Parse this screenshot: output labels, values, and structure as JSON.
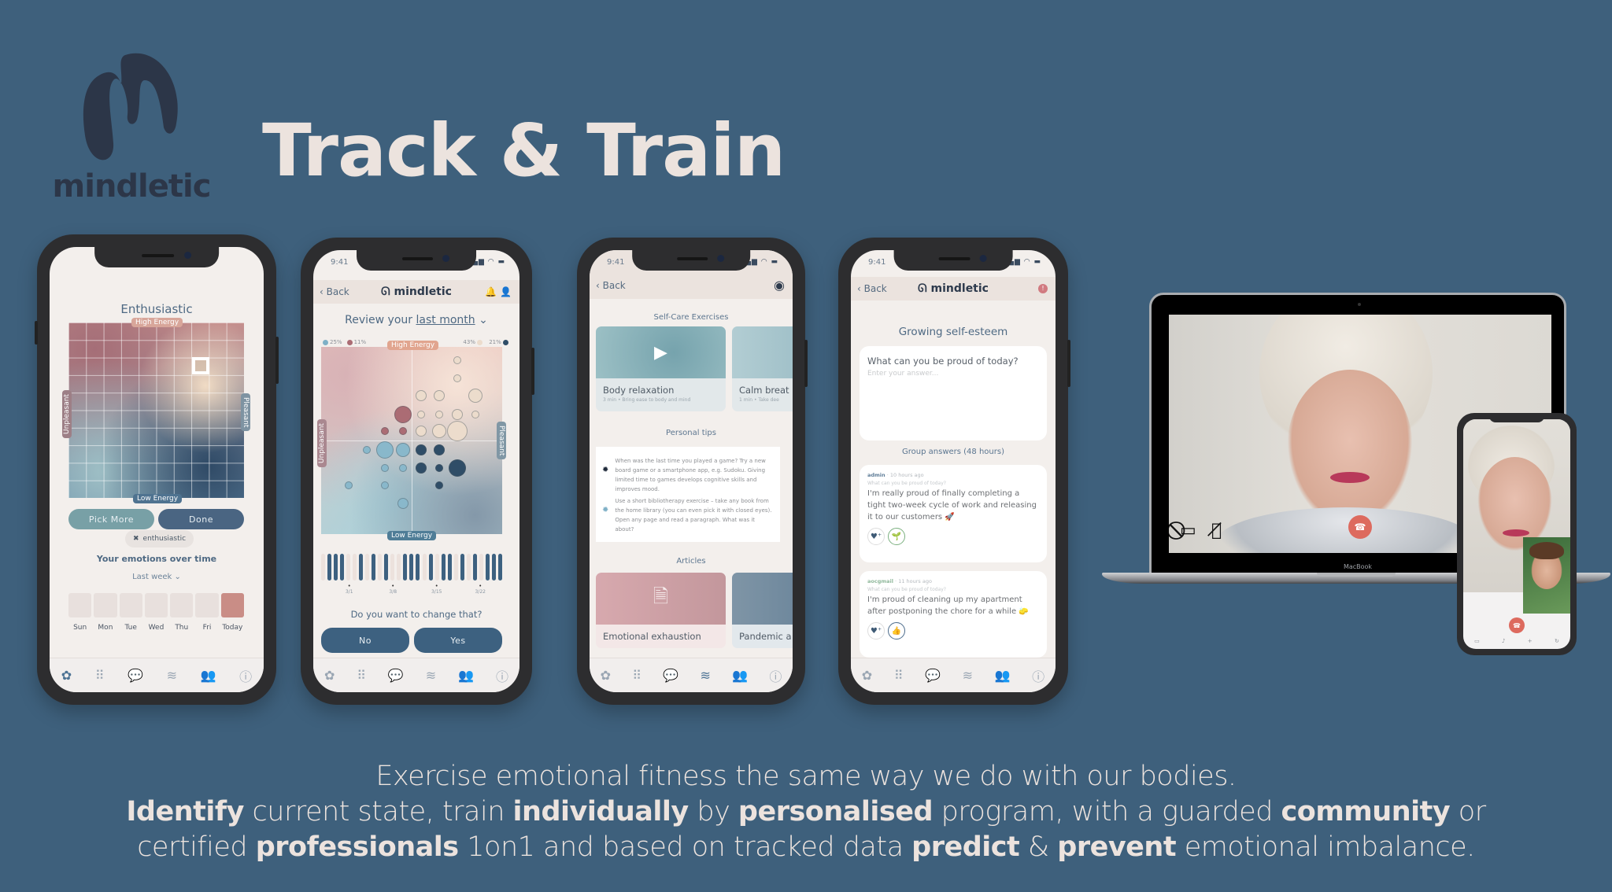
{
  "brand": {
    "name": "mindletic",
    "logo_icon": "mindletic-m-logo-icon"
  },
  "headline": "Track & Train",
  "tagline": {
    "line1": "Exercise emotional fitness the same way we do with our bodies.",
    "line2": [
      {
        "text": "Identify",
        "bold": true
      },
      {
        "text": " current state, train ",
        "bold": false
      },
      {
        "text": "individually",
        "bold": true
      },
      {
        "text": " by ",
        "bold": false
      },
      {
        "text": "personalised",
        "bold": true
      },
      {
        "text": " program, with a guarded ",
        "bold": false
      },
      {
        "text": "community",
        "bold": true
      },
      {
        "text": " or",
        "bold": false
      }
    ],
    "line3": [
      {
        "text": "certified ",
        "bold": false
      },
      {
        "text": "professionals",
        "bold": true
      },
      {
        "text": " 1on1 and based on tracked data ",
        "bold": false
      },
      {
        "text": "predict",
        "bold": true
      },
      {
        "text": " & ",
        "bold": false
      },
      {
        "text": "prevent",
        "bold": true
      },
      {
        "text": " emotional imbalance.",
        "bold": false
      }
    ]
  },
  "common": {
    "status_time": "9:41",
    "status_icons": "signal wifi battery",
    "back_label": "Back",
    "app_brand": "mindletic",
    "tabbar": [
      {
        "name": "tab-track",
        "icon": "lotus-icon",
        "glyph": "✿"
      },
      {
        "name": "tab-menu",
        "icon": "dots-grid-icon",
        "glyph": "⠿"
      },
      {
        "name": "tab-chat",
        "icon": "chat-bubbles-icon",
        "glyph": "💬"
      },
      {
        "name": "tab-exercises",
        "icon": "waves-icon",
        "glyph": "≋"
      },
      {
        "name": "tab-community",
        "icon": "people-icon",
        "glyph": "👥"
      },
      {
        "name": "tab-info",
        "icon": "info-icon",
        "glyph": "ⓘ"
      }
    ]
  },
  "phone1": {
    "emotion_title": "Enthusiastic",
    "axes": {
      "top": "High Energy",
      "bottom": "Low Energy",
      "left": "Unpleasant",
      "right": "Pleasant"
    },
    "pick_more_label": "Pick More",
    "done_label": "Done",
    "selected_chip": "enthusiastic",
    "emotions_over_time_label": "Your emotions over time",
    "period_dropdown": "Last week",
    "days": [
      "Sun",
      "Mon",
      "Tue",
      "Wed",
      "Thu",
      "Fri",
      "Today"
    ],
    "active_tab": 0
  },
  "phone2": {
    "title_prefix": "Review your ",
    "title_period": "last month",
    "legend": [
      {
        "pct": "25%",
        "color": "#7fb0c6"
      },
      {
        "pct": "11%",
        "color": "#ab6c74"
      },
      {
        "pct": "43%",
        "color": "#ecdccc"
      },
      {
        "pct": "21%",
        "color": "#2f4d67"
      }
    ],
    "axes": {
      "top": "High Energy",
      "bottom": "Low Energy",
      "left": "Unpleasant",
      "right": "Pleasant"
    },
    "bubbles": [
      {
        "x": 0.75,
        "y": 0.07,
        "r": 1,
        "c": "cream"
      },
      {
        "x": 0.75,
        "y": 0.17,
        "r": 1,
        "c": "cream"
      },
      {
        "x": 0.55,
        "y": 0.26,
        "r": 2,
        "c": "cream"
      },
      {
        "x": 0.65,
        "y": 0.26,
        "r": 2,
        "c": "cream"
      },
      {
        "x": 0.85,
        "y": 0.26,
        "r": 3,
        "c": "cream"
      },
      {
        "x": 0.45,
        "y": 0.36,
        "r": 4,
        "c": "rose"
      },
      {
        "x": 0.55,
        "y": 0.36,
        "r": 1,
        "c": "cream"
      },
      {
        "x": 0.65,
        "y": 0.36,
        "r": 1,
        "c": "cream"
      },
      {
        "x": 0.75,
        "y": 0.36,
        "r": 2,
        "c": "cream"
      },
      {
        "x": 0.85,
        "y": 0.36,
        "r": 1,
        "c": "cream"
      },
      {
        "x": 0.35,
        "y": 0.45,
        "r": 1,
        "c": "rose"
      },
      {
        "x": 0.45,
        "y": 0.45,
        "r": 1,
        "c": "rose"
      },
      {
        "x": 0.55,
        "y": 0.45,
        "r": 2,
        "c": "cream"
      },
      {
        "x": 0.65,
        "y": 0.45,
        "r": 3,
        "c": "cream"
      },
      {
        "x": 0.75,
        "y": 0.45,
        "r": 5,
        "c": "cream"
      },
      {
        "x": 0.25,
        "y": 0.55,
        "r": 1,
        "c": "blue"
      },
      {
        "x": 0.35,
        "y": 0.55,
        "r": 4,
        "c": "blue"
      },
      {
        "x": 0.45,
        "y": 0.55,
        "r": 3,
        "c": "blue"
      },
      {
        "x": 0.55,
        "y": 0.55,
        "r": 2,
        "c": "navy"
      },
      {
        "x": 0.65,
        "y": 0.55,
        "r": 2,
        "c": "navy"
      },
      {
        "x": 0.35,
        "y": 0.645,
        "r": 1,
        "c": "blue"
      },
      {
        "x": 0.45,
        "y": 0.645,
        "r": 1,
        "c": "blue"
      },
      {
        "x": 0.55,
        "y": 0.645,
        "r": 2,
        "c": "navy"
      },
      {
        "x": 0.65,
        "y": 0.645,
        "r": 1,
        "c": "navy"
      },
      {
        "x": 0.75,
        "y": 0.645,
        "r": 4,
        "c": "navy"
      },
      {
        "x": 0.15,
        "y": 0.74,
        "r": 1,
        "c": "blue"
      },
      {
        "x": 0.35,
        "y": 0.74,
        "r": 1,
        "c": "blue"
      },
      {
        "x": 0.65,
        "y": 0.74,
        "r": 1,
        "c": "navy"
      },
      {
        "x": 0.45,
        "y": 0.835,
        "r": 2,
        "c": "blue"
      }
    ],
    "daily_bars": [
      0,
      1,
      1,
      1,
      0,
      0,
      1,
      0,
      1,
      0,
      1,
      0,
      0,
      1,
      1,
      1,
      0,
      1,
      0,
      1,
      1,
      0,
      1,
      0,
      1,
      0,
      1,
      1,
      1
    ],
    "date_ticks": [
      "3/1",
      "3/8",
      "3/15",
      "3/22"
    ],
    "question": "Do you want to change that?",
    "no_label": "No",
    "yes_label": "Yes",
    "active_tab": 2
  },
  "phone3": {
    "self_care_heading": "Self-Care Exercises",
    "exercises": [
      {
        "title": "Body relaxation",
        "subtitle": "3 min • Bring ease to body and mind"
      },
      {
        "title": "Calm breat",
        "subtitle": "1 min • Take dee"
      }
    ],
    "tips_heading": "Personal tips",
    "tips": [
      "When was the last time you played a game? Try a new board game or a smartphone app, e.g. Sudoku. Giving limited time to games develops cognitive skills and improves mood.",
      "Use a short bibliotherapy exercise – take any book from the home library (you can even pick it with closed eyes). Open any page and read a paragraph. What was it about?"
    ],
    "articles_heading": "Articles",
    "articles": [
      {
        "title": "Emotional exhaustion"
      },
      {
        "title": "Pandemic a"
      }
    ],
    "active_tab": 3
  },
  "phone4": {
    "title": "Growing self-esteem",
    "question": "What can you be proud of today?",
    "answer_placeholder": "Enter your answer...",
    "group_answers_label": "Group answers (48 hours)",
    "answers": [
      {
        "user": "admin",
        "time": "10 hours ago",
        "question": "What can you be proud of today?",
        "text": "I'm really proud of finally completing a tight two-week cycle of work and releasing it to our customers 🚀",
        "reaction": "🌱"
      },
      {
        "user": "aocgmail",
        "time": "11 hours ago",
        "question": "What can you be proud of today?",
        "text": "I'm proud of cleaning up my apartment after postponing the chore for a while 🧽",
        "reaction": "👍"
      }
    ],
    "active_tab": 2
  },
  "video_call": {
    "laptop_label": "MacBook",
    "controls": [
      "camera-off-icon",
      "mic-off-icon",
      "end-call-icon"
    ]
  },
  "colors": {
    "background": "#3e607c",
    "headline": "#ece3de",
    "primary_button": "#3d6180",
    "secondary_button": "#78a0a6",
    "end_call": "#dd6a5e"
  }
}
